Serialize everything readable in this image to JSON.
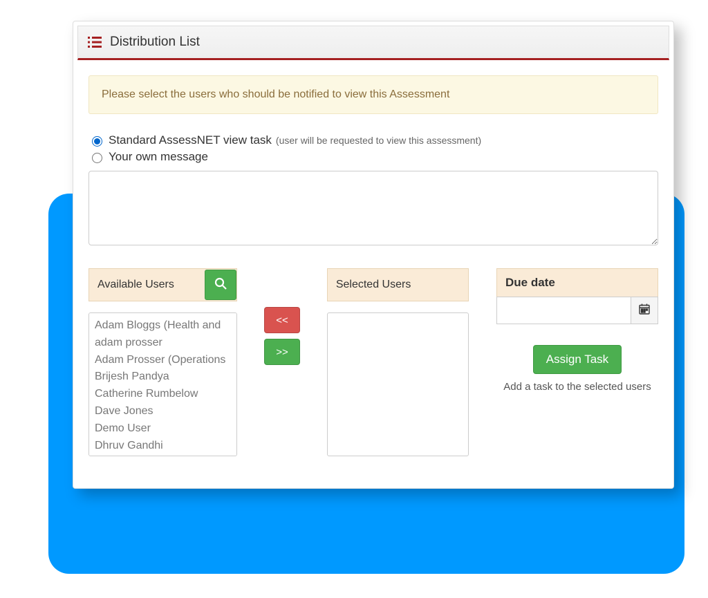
{
  "header": {
    "title": "Distribution List"
  },
  "alert": {
    "text": "Please select the users who should be notified to view this Assessment"
  },
  "radios": {
    "standard": {
      "label": "Standard AssessNET view task",
      "hint": "(user will be requested to view this assessment)",
      "checked": true
    },
    "own": {
      "label": "Your own message",
      "checked": false
    }
  },
  "message": {
    "value": ""
  },
  "available": {
    "title": "Available Users",
    "items": [
      "Adam Bloggs (Health and",
      "adam prosser",
      "Adam Prosser (Operations",
      "Brijesh Pandya",
      "Catherine Rumbelow",
      "Dave Jones",
      "Demo User",
      "Dhruv Gandhi"
    ]
  },
  "transfer": {
    "remove_label": "<<",
    "add_label": ">>"
  },
  "selected": {
    "title": "Selected Users",
    "items": []
  },
  "due": {
    "title": "Due date",
    "value": "",
    "assign_label": "Assign Task",
    "assign_hint": "Add a task to the selected users"
  }
}
